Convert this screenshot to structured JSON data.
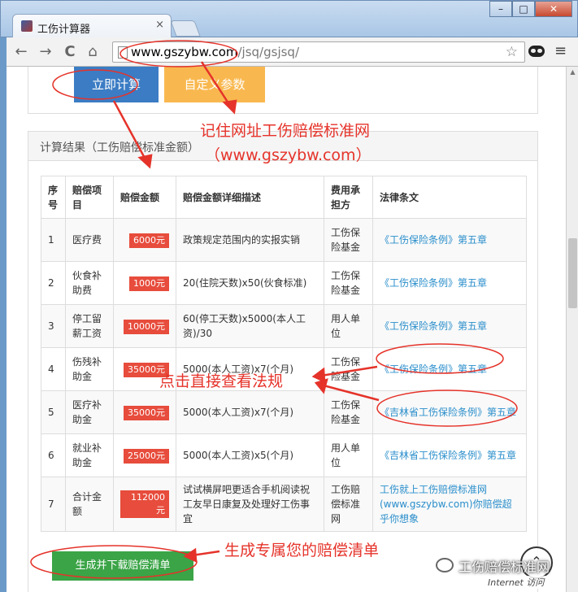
{
  "browser": {
    "tab_title": "工伤计算器",
    "tab_close": "×",
    "url_host": "www.gszybw.com",
    "url_path": "/jsq/gsjsq/",
    "back": "←",
    "forward": "→",
    "reload": "C",
    "home": "⌂",
    "star": "☆",
    "menu": "≡",
    "win_min": "–",
    "win_max": "□",
    "win_close": "✕"
  },
  "page": {
    "calc_button": "立即计算",
    "custom_button": "自定义参数",
    "result_heading": "计算结果（工伤赔偿标准金额）",
    "table": {
      "headers": [
        "序号",
        "赔偿项目",
        "赔偿金额",
        "赔偿金额详细描述",
        "费用承担方",
        "法律条文"
      ],
      "rows": [
        {
          "no": "1",
          "item": "医疗费",
          "amount": "6000元",
          "desc": "政策规定范围内的实报实销",
          "payer": "工伤保险基金",
          "law": "《工伤保险条例》第五章"
        },
        {
          "no": "2",
          "item": "伙食补助费",
          "amount": "1000元",
          "desc": "20(住院天数)x50(伙食标准)",
          "payer": "工伤保险基金",
          "law": "《工伤保险条例》第五章"
        },
        {
          "no": "3",
          "item": "停工留薪工资",
          "amount": "10000元",
          "desc": "60(停工天数)x5000(本人工资)/30",
          "payer": "用人单位",
          "law": "《工伤保险条例》第五章"
        },
        {
          "no": "4",
          "item": "伤残补助金",
          "amount": "35000元",
          "desc": "5000(本人工资)x7(个月)",
          "payer": "工伤保险基金",
          "law": "《工伤保险条例》第五章"
        },
        {
          "no": "5",
          "item": "医疗补助金",
          "amount": "35000元",
          "desc": "5000(本人工资)x7(个月)",
          "payer": "工伤保险基金",
          "law": "《吉林省工伤保险条例》第五章"
        },
        {
          "no": "6",
          "item": "就业补助金",
          "amount": "25000元",
          "desc": "5000(本人工资)x5(个月)",
          "payer": "用人单位",
          "law": "《吉林省工伤保险条例》第五章"
        },
        {
          "no": "7",
          "item": "合计金额",
          "amount": "112000元",
          "desc": "试试横屏吧更适合手机阅读祝工友早日康复及处理好工伤事宜",
          "payer": "工伤赔偿标准网",
          "law": "工伤就上工伤赔偿标准网(www.gszybw.com)你赔偿超乎你想象"
        }
      ]
    },
    "generate_button": "生成并下载赔偿清单",
    "back_to_top": "⌃"
  },
  "annotations": {
    "remember_url": "记住网址工伤赔偿标准网",
    "remember_url_2": "（www.gszybw.com）",
    "click_law": "点击直接查看法规",
    "generate_list": "生成专属您的赔偿清单",
    "watermark": "工伤赔偿标准网",
    "ie_badge": "Internet 访问"
  },
  "colors": {
    "annotation": "#e5332a",
    "calc_button": "#3b7cc4",
    "custom_button": "#f9b84f",
    "amount_badge": "#e74c3c",
    "law_link": "#2a8ecb",
    "generate_button": "#3aa446"
  }
}
